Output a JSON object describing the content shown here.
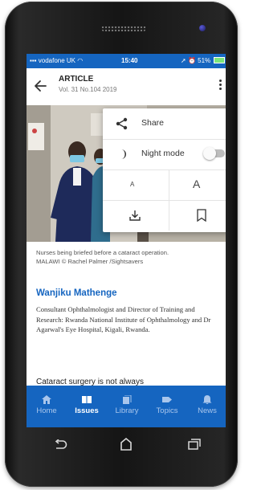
{
  "status_bar": {
    "carrier": "vodafone UK",
    "time": "15:40",
    "battery": "51%"
  },
  "app_bar": {
    "title": "ARTICLE",
    "subtitle": "Vol. 31 No.104 2019"
  },
  "menu": {
    "share_label": "Share",
    "night_mode_label": "Night mode",
    "night_mode_on": false,
    "font_small": "A",
    "font_large": "A"
  },
  "article": {
    "caption_line1": "Nurses being briefed before a cataract operation.",
    "caption_line2": "MALAWI © Rachel Palmer /Sightsavers",
    "author": "Wanjiku Mathenge",
    "bio": "Consultant Ophthalmologist and Director of Training and Research: Rwanda National Institute of Ophthalmology and Dr Agarwal's Eye Hospital, Kigali, Rwanda.",
    "body_start": "Cataract surgery is not always"
  },
  "bottom_nav": {
    "items": [
      {
        "label": "Home",
        "icon": "home-icon",
        "active": false
      },
      {
        "label": "Issues",
        "icon": "issues-icon",
        "active": true
      },
      {
        "label": "Library",
        "icon": "library-icon",
        "active": false
      },
      {
        "label": "Topics",
        "icon": "topics-icon",
        "active": false
      },
      {
        "label": "News",
        "icon": "news-icon",
        "active": false
      }
    ]
  },
  "colors": {
    "brand_blue": "#1565c0",
    "link_blue": "#1565c0"
  }
}
